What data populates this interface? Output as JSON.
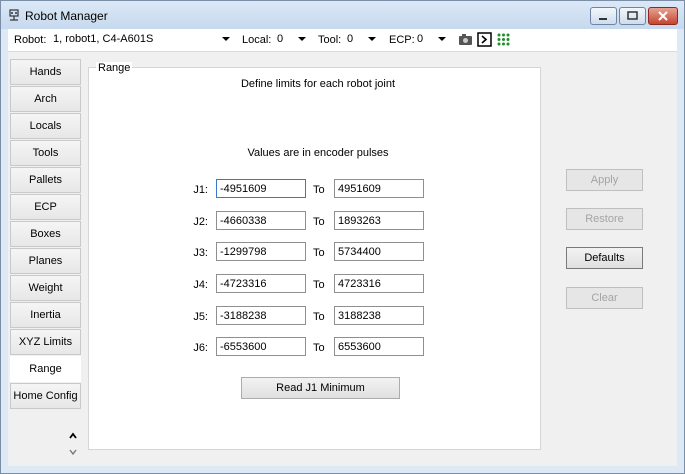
{
  "window": {
    "title": "Robot Manager"
  },
  "toolbar": {
    "robot_label": "Robot:",
    "robot_value": "1, robot1, C4-A601S",
    "local_label": "Local:",
    "local_value": "0",
    "tool_label": "Tool:",
    "tool_value": "0",
    "ecp_label": "ECP:",
    "ecp_value": "0",
    "icons": [
      "camera-icon",
      "terminal-icon",
      "io-grid-icon"
    ]
  },
  "sidebar": {
    "items": [
      {
        "label": "Hands"
      },
      {
        "label": "Arch"
      },
      {
        "label": "Locals"
      },
      {
        "label": "Tools"
      },
      {
        "label": "Pallets"
      },
      {
        "label": "ECP"
      },
      {
        "label": "Boxes"
      },
      {
        "label": "Planes"
      },
      {
        "label": "Weight"
      },
      {
        "label": "Inertia"
      },
      {
        "label": "XYZ Limits"
      },
      {
        "label": "Range",
        "active": true
      },
      {
        "label": "Home Config"
      }
    ]
  },
  "range": {
    "legend": "Range",
    "heading": "Define limits for each robot joint",
    "units_note": "Values are in encoder pulses",
    "to_label": "To",
    "joints": [
      {
        "label": "J1:",
        "min": "-4951609",
        "max": "4951609"
      },
      {
        "label": "J2:",
        "min": "-4660338",
        "max": "1893263"
      },
      {
        "label": "J3:",
        "min": "-1299798",
        "max": "5734400"
      },
      {
        "label": "J4:",
        "min": "-4723316",
        "max": "4723316"
      },
      {
        "label": "J5:",
        "min": "-3188238",
        "max": "3188238"
      },
      {
        "label": "J6:",
        "min": "-6553600",
        "max": "6553600"
      }
    ],
    "read_button": "Read J1 Minimum"
  },
  "actions": {
    "apply": "Apply",
    "restore": "Restore",
    "defaults": "Defaults",
    "clear": "Clear"
  },
  "colors": {
    "title_bar": "#c7d9ee",
    "client_bg": "#f0f0f0",
    "close_button": "#c4452f",
    "focus_border": "#3b78c8"
  }
}
